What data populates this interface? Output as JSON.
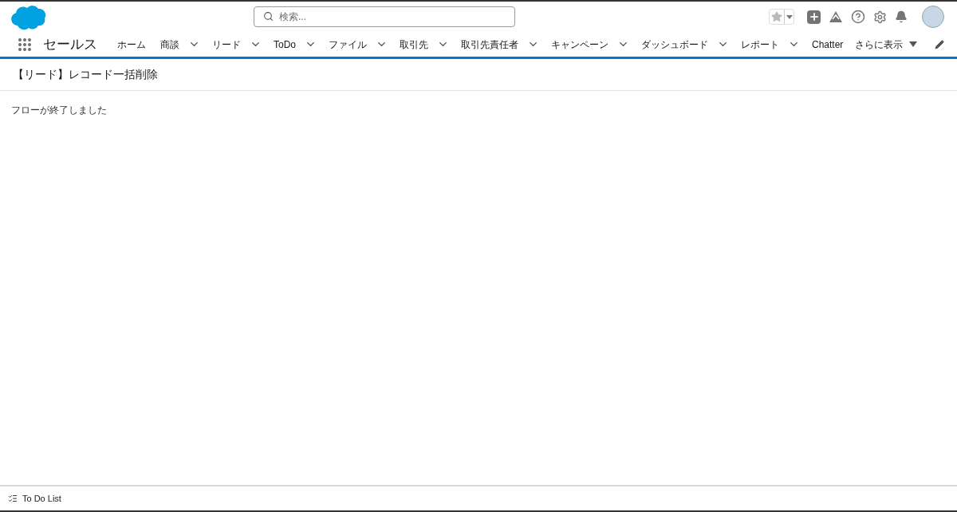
{
  "header": {
    "search": {
      "placeholder": "検索..."
    }
  },
  "nav": {
    "app_name": "セールス",
    "items": [
      {
        "label": "ホーム",
        "has_menu": false
      },
      {
        "label": "商談",
        "has_menu": true
      },
      {
        "label": "リード",
        "has_menu": true
      },
      {
        "label": "ToDo",
        "has_menu": true
      },
      {
        "label": "ファイル",
        "has_menu": true
      },
      {
        "label": "取引先",
        "has_menu": true
      },
      {
        "label": "取引先責任者",
        "has_menu": true
      },
      {
        "label": "キャンペーン",
        "has_menu": true
      },
      {
        "label": "ダッシュボード",
        "has_menu": true
      },
      {
        "label": "レポート",
        "has_menu": true
      },
      {
        "label": "Chatter",
        "has_menu": false
      }
    ],
    "more": "さらに表示"
  },
  "page": {
    "title": "【リード】レコード一括削除",
    "message": "フローが終了しました"
  },
  "footer": {
    "utility": "To Do List"
  }
}
